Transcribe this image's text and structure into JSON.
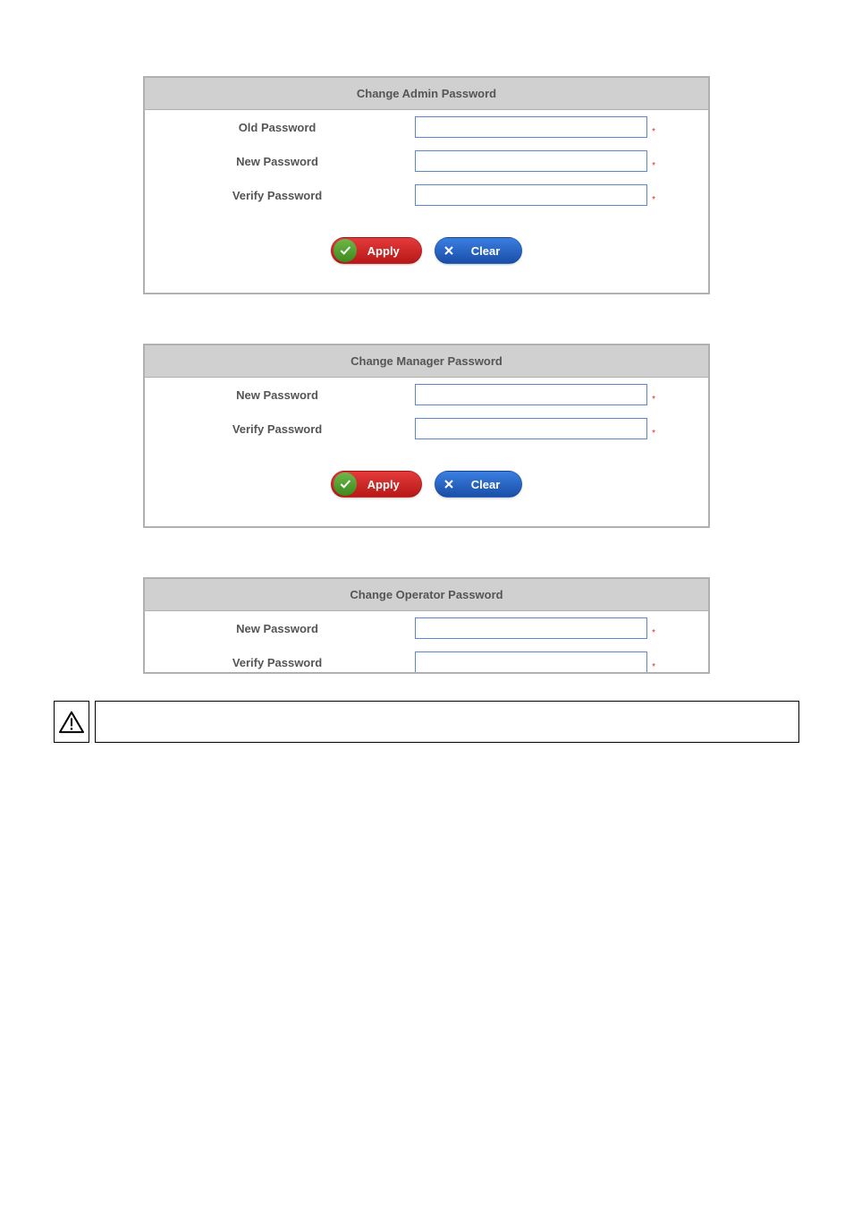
{
  "sections": {
    "admin": {
      "title": "Change Admin Password",
      "fields": {
        "old_password": {
          "label": "Old Password",
          "value": ""
        },
        "new_password": {
          "label": "New Password",
          "value": ""
        },
        "verify_password": {
          "label": "Verify Password",
          "value": ""
        }
      },
      "buttons": {
        "apply": "Apply",
        "clear": "Clear"
      }
    },
    "manager": {
      "title": "Change Manager Password",
      "fields": {
        "new_password": {
          "label": "New Password",
          "value": ""
        },
        "verify_password": {
          "label": "Verify Password",
          "value": ""
        }
      },
      "buttons": {
        "apply": "Apply",
        "clear": "Clear"
      }
    },
    "operator": {
      "title": "Change Operator Password",
      "fields": {
        "new_password": {
          "label": "New Password",
          "value": ""
        },
        "verify_password": {
          "label": "Verify Password",
          "value": ""
        }
      }
    }
  },
  "note": {
    "text": ""
  }
}
